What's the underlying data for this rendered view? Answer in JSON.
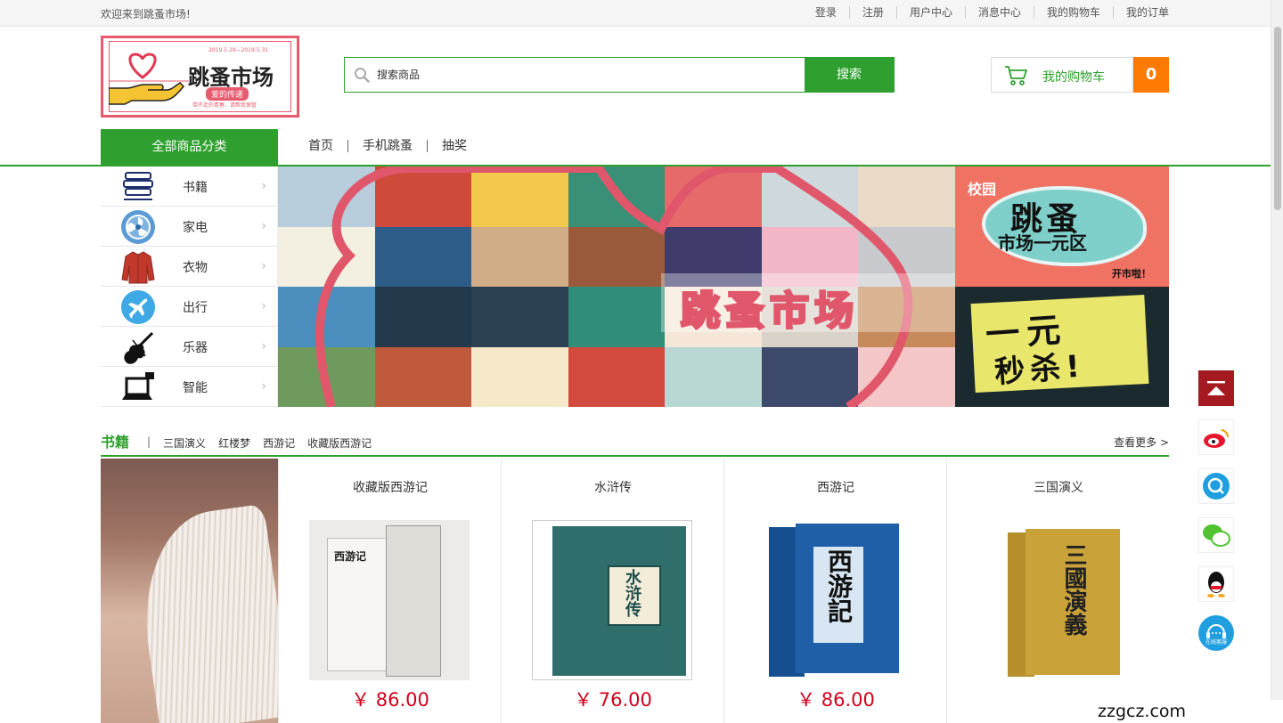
{
  "topbar": {
    "welcome": "欢迎来到跳蚤市场!",
    "links": [
      "登录",
      "注册",
      "用户中心",
      "消息中心",
      "我的购物车",
      "我的订单"
    ]
  },
  "logo": {
    "title": "跳蚤市场",
    "subtitle": "爱的传递",
    "tagline": "带不走的青春，请帮我保管",
    "dates": "2019.5.29—2019.5.31"
  },
  "search": {
    "placeholder": "搜索商品",
    "button": "搜索"
  },
  "cart": {
    "label": "我的购物车",
    "count": "0"
  },
  "nav": {
    "all_label": "全部商品分类",
    "links": [
      "首页",
      "手机跳蚤",
      "抽奖"
    ]
  },
  "categories": [
    {
      "label": "书籍",
      "icon": "logo-stack-icon"
    },
    {
      "label": "家电",
      "icon": "fan-icon"
    },
    {
      "label": "衣物",
      "icon": "jacket-icon"
    },
    {
      "label": "出行",
      "icon": "airplane-icon"
    },
    {
      "label": "乐器",
      "icon": "violin-icon"
    },
    {
      "label": "智能",
      "icon": "laptop-icon"
    }
  ],
  "banner": {
    "text": "跳蚤市场"
  },
  "side_banners": [
    {
      "t1": "校园",
      "t2": "跳蚤",
      "t3": "市场一元区",
      "t4": "开市啦！"
    },
    {
      "t1": "一元",
      "t2": "秒杀!"
    }
  ],
  "section": {
    "title": "书籍",
    "tags": [
      "三国演义",
      "红楼梦",
      "西游记",
      "收藏版西游记"
    ],
    "more": "查看更多 >"
  },
  "products": [
    {
      "name": "收藏版西游记",
      "price": "￥ 86.00",
      "cover_color": "#e8e6e2",
      "cover_text": "西游记"
    },
    {
      "name": "水浒传",
      "price": "￥ 76.00",
      "cover_color": "#2f6e6a",
      "cover_text": "水浒传"
    },
    {
      "name": "西游记",
      "price": "￥ 86.00",
      "cover_color": "#1e5fa8",
      "cover_text": "西游記"
    },
    {
      "name": "三国演义",
      "price": "",
      "cover_color": "#caa23a",
      "cover_text": "三國演義"
    }
  ],
  "float_bar": {
    "items": [
      "back-to-top-icon",
      "weibo-icon",
      "qzone-icon",
      "wechat-icon",
      "qq-icon",
      "online-service-icon"
    ],
    "service_label": "在线客服"
  },
  "watermark": "zzgcz.com",
  "colors": {
    "accent": "#2fa02f",
    "price": "#d0021b",
    "cart_count": "#ff7a00"
  }
}
